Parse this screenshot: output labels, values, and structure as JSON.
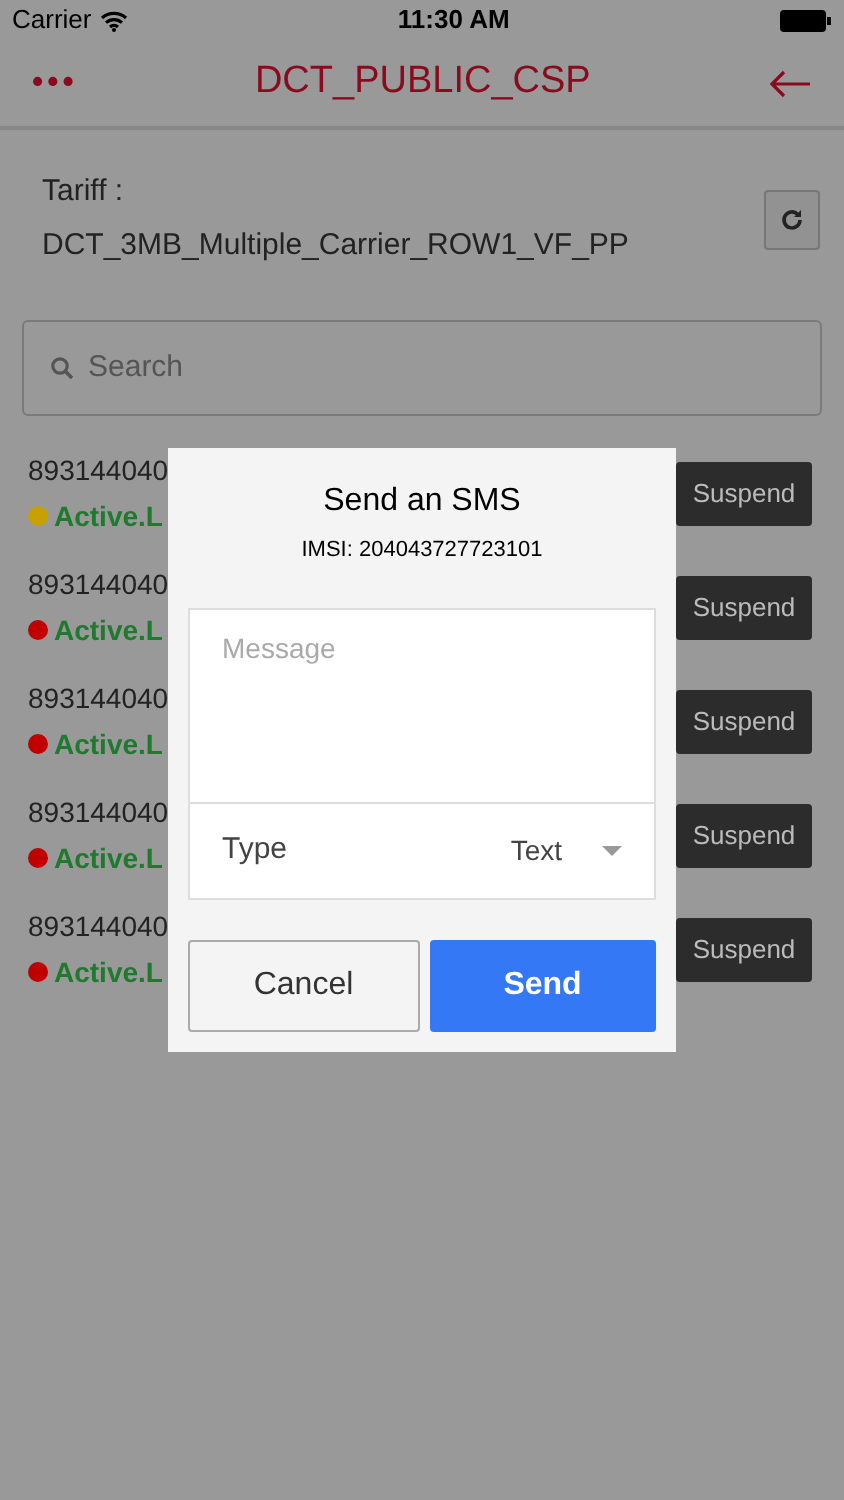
{
  "status_bar": {
    "carrier": "Carrier",
    "time": "11:30 AM"
  },
  "nav": {
    "menu": "•••",
    "title": "DCT_PUBLIC_CSP"
  },
  "tariff": {
    "label": "Tariff :",
    "value": "DCT_3MB_Multiple_Carrier_ROW1_VF_PP"
  },
  "search": {
    "placeholder": "Search"
  },
  "rows": [
    {
      "id": "893144040",
      "status": "Active.L",
      "color": "#c8a000",
      "action": "Suspend"
    },
    {
      "id": "893144040",
      "status": "Active.L",
      "color": "#c00000",
      "action": "Suspend"
    },
    {
      "id": "893144040",
      "status": "Active.L",
      "color": "#c00000",
      "action": "Suspend"
    },
    {
      "id": "893144040",
      "status": "Active.L",
      "color": "#c00000",
      "action": "Suspend"
    },
    {
      "id": "893144040",
      "status": "Active.L",
      "color": "#c00000",
      "action": "Suspend"
    }
  ],
  "dialog": {
    "title": "Send an SMS",
    "subtitle": "IMSI: 204043727723101",
    "message_placeholder": "Message",
    "type_label": "Type",
    "type_value": "Text",
    "buttons": [
      {
        "label": "Cancel",
        "kind": "secondary"
      },
      {
        "label": "Send",
        "kind": "primary"
      }
    ]
  }
}
